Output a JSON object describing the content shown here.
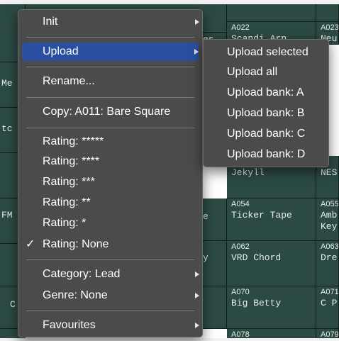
{
  "patch_grid": {
    "cells": [
      {
        "code": "A022",
        "name": "Scandi Arp"
      },
      {
        "code": "A023",
        "name": "Neu"
      },
      {
        "code": "",
        "name": "Jekyll"
      },
      {
        "code": "",
        "name": "NES"
      },
      {
        "code": "A054",
        "name": "Ticker Tape"
      },
      {
        "code": "A055",
        "name": "Amb\nKey"
      },
      {
        "code": "A062",
        "name": "VRD Chord"
      },
      {
        "code": "A063",
        "name": "Dre"
      },
      {
        "code": "A070",
        "name": "Big Betty"
      },
      {
        "code": "A071",
        "name": "C P"
      },
      {
        "code": "A078",
        "name": ""
      },
      {
        "code": "A079",
        "name": ""
      }
    ],
    "left_fragments": [
      "Me",
      "tc",
      "FM",
      "C"
    ],
    "middle_fragments": [
      "es",
      "e",
      "y"
    ]
  },
  "context_menu": {
    "items": [
      {
        "label": "Init",
        "submenu": true
      },
      {
        "label": "Upload",
        "submenu": true,
        "selected": true
      },
      {
        "label": "Rename..."
      },
      {
        "label": "Copy: A011: Bare Square"
      },
      {
        "label": "Rating: *****"
      },
      {
        "label": "Rating: ****"
      },
      {
        "label": "Rating: ***"
      },
      {
        "label": "Rating: **"
      },
      {
        "label": "Rating: *"
      },
      {
        "label": "Rating: None",
        "checked": true,
        "check": "✓"
      },
      {
        "label": "Category: Lead",
        "submenu": true
      },
      {
        "label": "Genre: None",
        "submenu": true
      },
      {
        "label": "Favourites",
        "submenu": true
      }
    ]
  },
  "upload_submenu": {
    "items": [
      {
        "label": "Upload selected"
      },
      {
        "label": "Upload all"
      },
      {
        "label": "Upload bank: A"
      },
      {
        "label": "Upload bank: B"
      },
      {
        "label": "Upload bank: C"
      },
      {
        "label": "Upload bank: D"
      }
    ]
  },
  "colors": {
    "cell_bg": "#2c4a44",
    "menu_bg": "#4b4b4b",
    "highlight": "#2a4ea0",
    "text": "#ffffff"
  }
}
